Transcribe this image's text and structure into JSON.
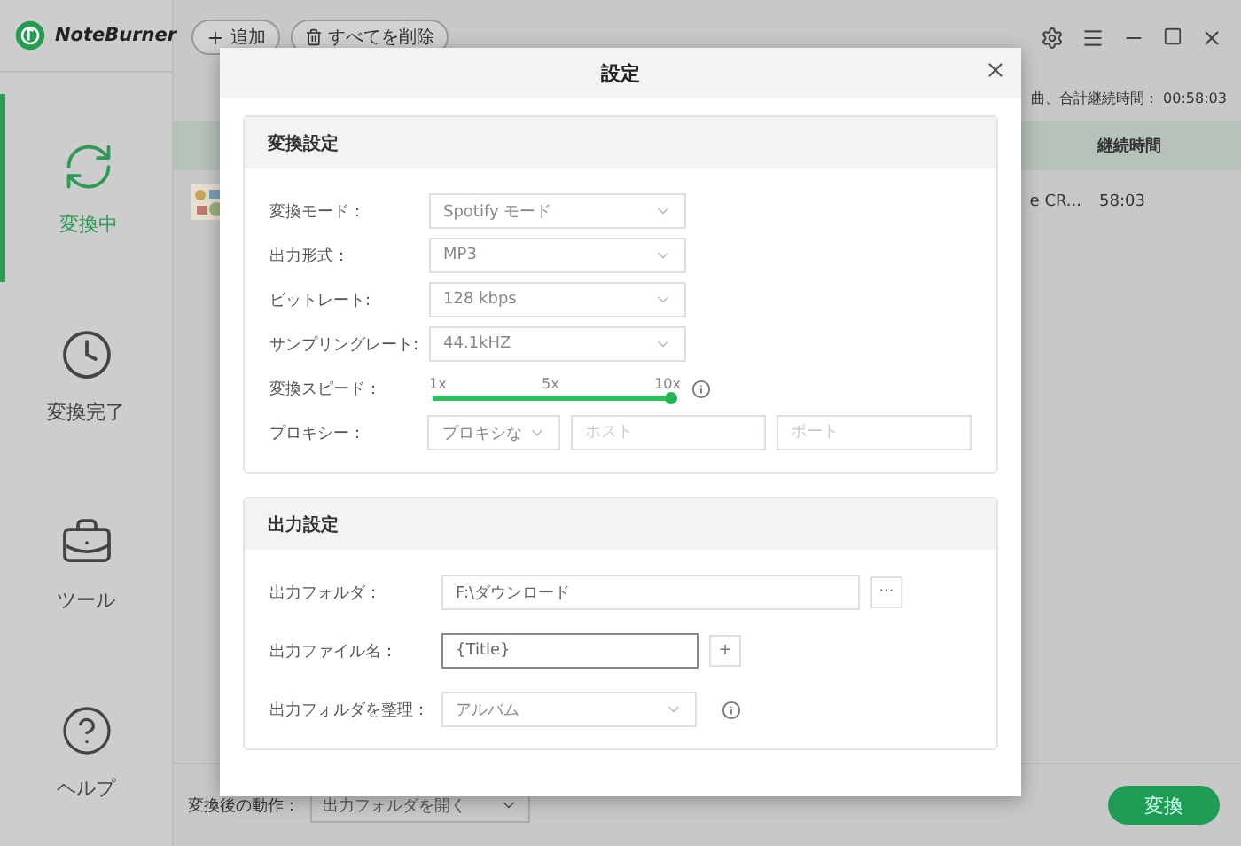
{
  "app": {
    "name": "NoteBurner"
  },
  "sidebar": {
    "items": [
      {
        "kind": "converting",
        "label": "変換中",
        "selected": true
      },
      {
        "kind": "done",
        "label": "変換完了",
        "selected": false
      },
      {
        "kind": "tools",
        "label": "ツール",
        "selected": false
      },
      {
        "kind": "help",
        "label": "ヘルプ",
        "selected": false
      }
    ]
  },
  "toolbar": {
    "buttons": [
      {
        "kind": "add",
        "label": "追加"
      },
      {
        "kind": "delete",
        "label": "すべてを削除"
      }
    ]
  },
  "summary": "曲、合計継続時間： 00:58:03",
  "table": {
    "columns": [
      "継続時間"
    ],
    "rows": [
      {
        "column_1": "e CR...",
        "duration": "58:03"
      }
    ]
  },
  "bottom": {
    "label": "変換後の動作：",
    "value": "出力フォルダを開く",
    "button": "変換"
  },
  "dialog": {
    "title": "設定",
    "sections": [
      {
        "title": "変換設定",
        "rows": [
          {
            "kind": "select",
            "label": "変換モード：",
            "value": "Spotify モード"
          },
          {
            "kind": "select",
            "label": "出力形式：",
            "value": "MP3"
          },
          {
            "kind": "select",
            "label": "ビットレート:",
            "value": "128 kbps"
          },
          {
            "kind": "select",
            "label": "サンプリングレート:",
            "value": "44.1kHZ"
          },
          {
            "kind": "slider",
            "label": "変換スピード：",
            "ticks": [
              "1x",
              "5x",
              "10x"
            ],
            "level": 1
          },
          {
            "kind": "proxy",
            "label": "プロキシー：",
            "value": "プロキシな",
            "host_placeholder": "ホスト",
            "port_placeholder": "ポート"
          }
        ]
      },
      {
        "title": "出力設定",
        "rows": [
          {
            "kind": "folder",
            "label": "出力フォルダ：",
            "value": "F:\\ダウンロード",
            "button": "···"
          },
          {
            "kind": "text",
            "label": "出力ファイル名：",
            "value": "{Title}",
            "button": "+",
            "focused": true
          },
          {
            "kind": "select_info",
            "label": "出力フォルダを整理：",
            "value": "アルバム"
          }
        ]
      }
    ]
  }
}
